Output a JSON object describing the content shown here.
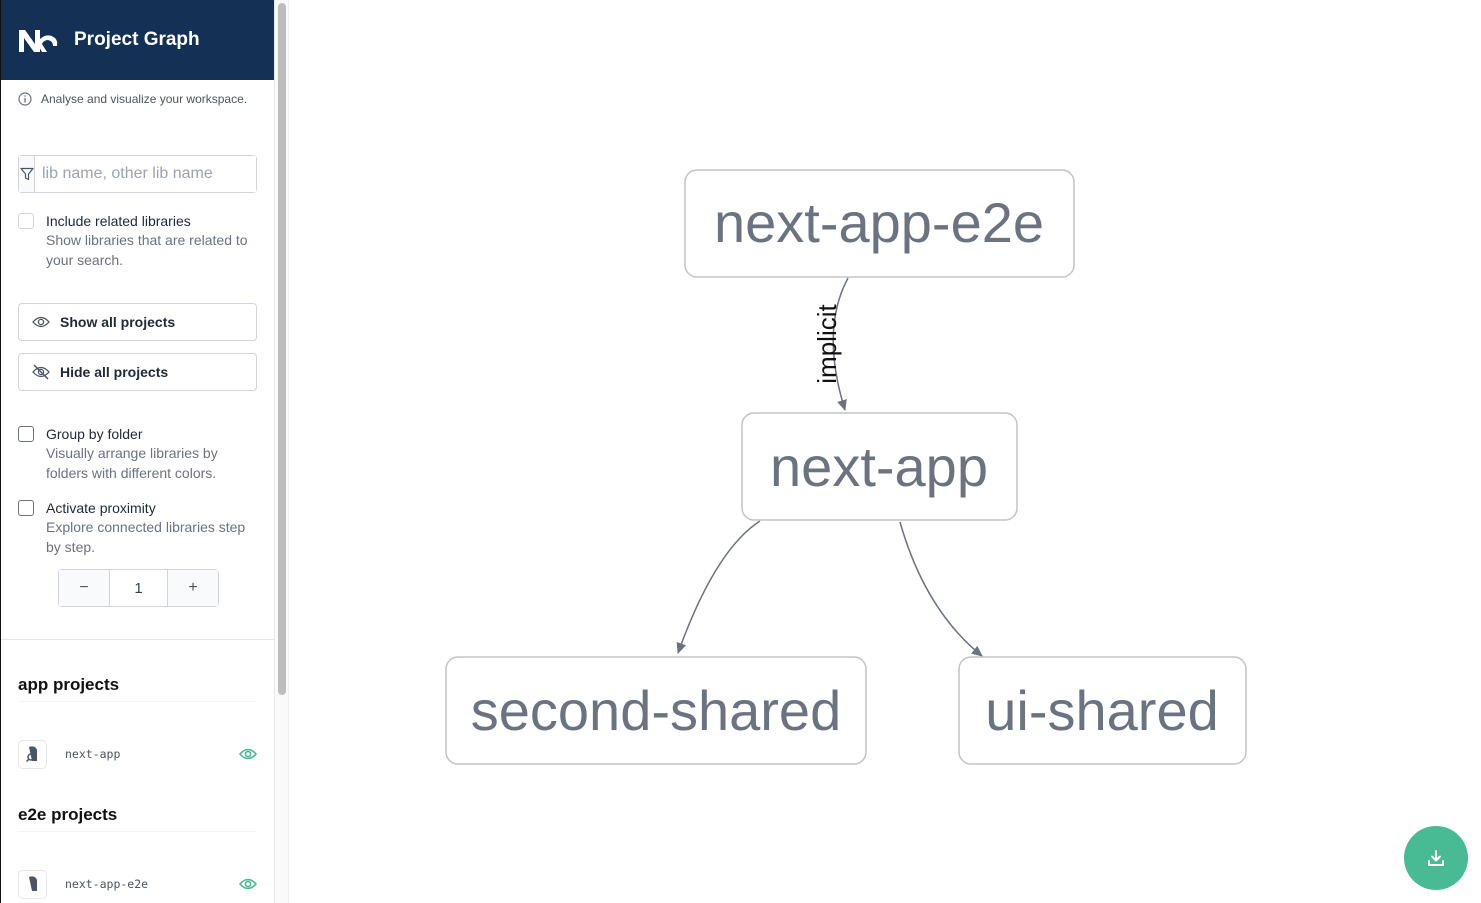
{
  "header": {
    "title": "Project Graph",
    "logo": "nx-logo"
  },
  "info": {
    "text": "Analyse and visualize your workspace.",
    "icon": "info-icon"
  },
  "filter": {
    "placeholder": "lib name, other lib name",
    "value": "",
    "icon": "filter-icon"
  },
  "options": {
    "include_related": {
      "title": "Include related libraries",
      "description": "Show libraries that are related to your search.",
      "checked": false
    },
    "group_by_folder": {
      "title": "Group by folder",
      "description": "Visually arrange libraries by folders with different colors.",
      "checked": false
    },
    "activate_proximity": {
      "title": "Activate proximity",
      "description": "Explore connected libraries step by step.",
      "checked": false
    }
  },
  "buttons": {
    "show_all": "Show all projects",
    "hide_all": "Hide all projects"
  },
  "stepper": {
    "minus": "−",
    "value": "1",
    "plus": "+"
  },
  "groups": [
    {
      "title": "app projects",
      "projects": [
        {
          "name": "next-app",
          "visible": true
        }
      ]
    },
    {
      "title": "e2e projects",
      "projects": [
        {
          "name": "next-app-e2e",
          "visible": true
        }
      ]
    }
  ],
  "graph": {
    "nodes": [
      {
        "id": "next-app-e2e",
        "label": "next-app-e2e"
      },
      {
        "id": "next-app",
        "label": "next-app"
      },
      {
        "id": "second-shared",
        "label": "second-shared"
      },
      {
        "id": "ui-shared",
        "label": "ui-shared"
      }
    ],
    "edges": [
      {
        "from": "next-app-e2e",
        "to": "next-app",
        "label": "implicit"
      },
      {
        "from": "next-app",
        "to": "second-shared",
        "label": ""
      },
      {
        "from": "next-app",
        "to": "ui-shared",
        "label": ""
      }
    ]
  },
  "colors": {
    "header_bg": "#143055",
    "accent": "#48bb94",
    "edge": "#6b7280",
    "node_border": "#c4c4c4"
  },
  "fab": {
    "icon": "download-icon"
  }
}
